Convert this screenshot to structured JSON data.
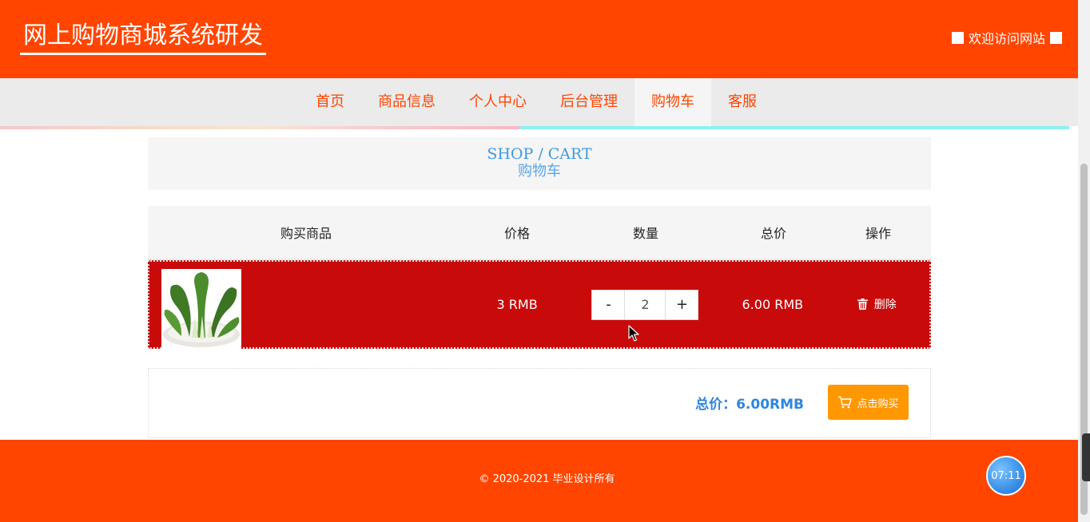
{
  "header": {
    "site_title": "网上购物商城系统研发",
    "welcome": "欢迎访问网站"
  },
  "nav": {
    "items": [
      {
        "label": "首页",
        "active": false
      },
      {
        "label": "商品信息",
        "active": false
      },
      {
        "label": "个人中心",
        "active": false
      },
      {
        "label": "后台管理",
        "active": false
      },
      {
        "label": "购物车",
        "active": true
      },
      {
        "label": "客服",
        "active": false
      }
    ]
  },
  "section": {
    "title_en": "SHOP / CART",
    "title_cn": "购物车"
  },
  "table": {
    "headers": [
      "购买商品",
      "价格",
      "数量",
      "总价",
      "操作"
    ],
    "rows": [
      {
        "image": "bok-choy-image",
        "price": "3 RMB",
        "quantity": "2",
        "total": "6.00 RMB",
        "delete_label": "删除"
      }
    ]
  },
  "qty_controls": {
    "minus": "-",
    "plus": "+"
  },
  "summary": {
    "total_label": "总价：6.00RMB",
    "buy_label": "点击购买"
  },
  "footer": {
    "copyright": "© 2020-2021 毕业设计所有",
    "timer": "07:11"
  },
  "colors": {
    "brand": "#ff4500",
    "row_bg": "#c90a0a",
    "accent_blue": "#2e86de",
    "buy_button": "#ff9800"
  }
}
